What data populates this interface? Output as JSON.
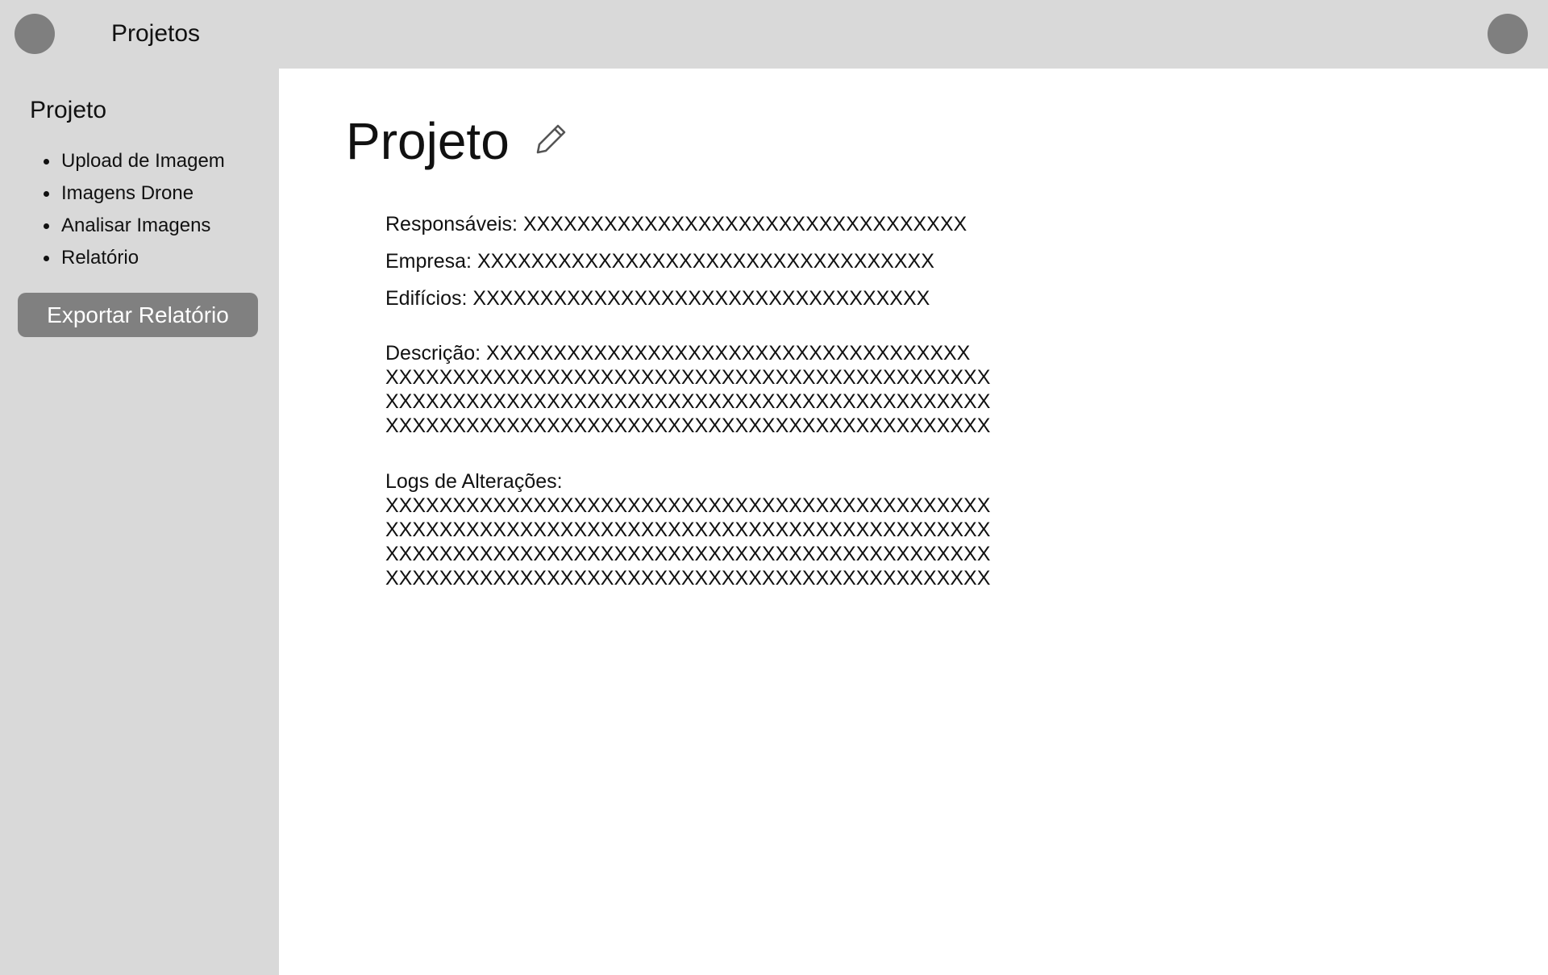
{
  "header": {
    "title": "Projetos",
    "left_icon": "avatar-icon",
    "right_icon": "avatar-icon"
  },
  "sidebar": {
    "title": "Projeto",
    "items": [
      {
        "label": "Upload de Imagem"
      },
      {
        "label": "Imagens Drone"
      },
      {
        "label": "Analisar Imagens"
      },
      {
        "label": "Relatório"
      }
    ],
    "export_button": "Exportar Relatório"
  },
  "main": {
    "title": "Projeto",
    "edit_icon": "pencil-icon",
    "responsaveis": {
      "label": "Responsáveis:",
      "value": "XXXXXXXXXXXXXXXXXXXXXXXXXXXXXXXXX"
    },
    "empresa": {
      "label": "Empresa:",
      "value": "XXXXXXXXXXXXXXXXXXXXXXXXXXXXXXXXXX"
    },
    "edificios": {
      "label": "Edifícios:",
      "value": "XXXXXXXXXXXXXXXXXXXXXXXXXXXXXXXXXX"
    },
    "descricao": {
      "label": "Descrição:",
      "lines": [
        "XXXXXXXXXXXXXXXXXXXXXXXXXXXXXXXXXXXX",
        "XXXXXXXXXXXXXXXXXXXXXXXXXXXXXXXXXXXXXXXXXXXXX",
        "XXXXXXXXXXXXXXXXXXXXXXXXXXXXXXXXXXXXXXXXXXXXX",
        "XXXXXXXXXXXXXXXXXXXXXXXXXXXXXXXXXXXXXXXXXXXXX"
      ]
    },
    "logs": {
      "label": "Logs de Alterações:",
      "lines": [
        "XXXXXXXXXXXXXXXXXXXXXXXXXXXXXXXXXXXXXXXXXXXXX",
        "XXXXXXXXXXXXXXXXXXXXXXXXXXXXXXXXXXXXXXXXXXXXX",
        "XXXXXXXXXXXXXXXXXXXXXXXXXXXXXXXXXXXXXXXXXXXXX",
        "XXXXXXXXXXXXXXXXXXXXXXXXXXXXXXXXXXXXXXXXXXXXX"
      ]
    }
  }
}
